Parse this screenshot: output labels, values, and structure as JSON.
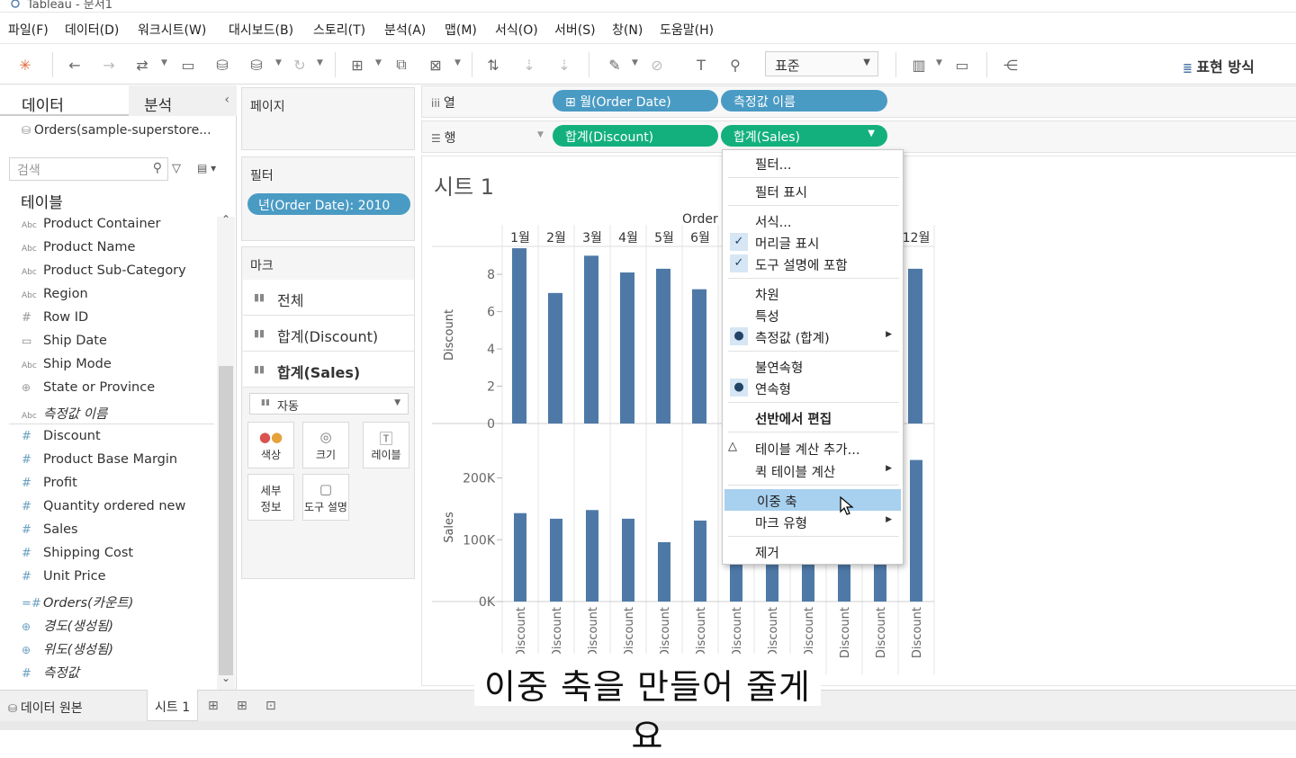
{
  "window": {
    "title": "Tableau - 문서1"
  },
  "menu": [
    "파일(F)",
    "데이터(D)",
    "워크시트(W)",
    "대시보드(B)",
    "스토리(T)",
    "분석(A)",
    "맵(M)",
    "서식(O)",
    "서버(S)",
    "창(N)",
    "도움말(H)"
  ],
  "toolbar": {
    "fit": "표준",
    "show_me": "표현 방식"
  },
  "data_pane": {
    "tab_data": "데이터",
    "tab_analysis": "분석",
    "datasource": "Orders(sample-superstore...",
    "search_placeholder": "검색",
    "tables_header": "테이블",
    "dimensions": [
      {
        "icon": "Abc",
        "label": "Product Container"
      },
      {
        "icon": "Abc",
        "label": "Product Name"
      },
      {
        "icon": "Abc",
        "label": "Product Sub-Category"
      },
      {
        "icon": "Abc",
        "label": "Region"
      },
      {
        "icon": "#",
        "label": "Row ID"
      },
      {
        "icon": "calendar",
        "label": "Ship Date"
      },
      {
        "icon": "Abc",
        "label": "Ship Mode"
      },
      {
        "icon": "globe",
        "label": "State or Province"
      },
      {
        "icon": "Abc",
        "label": "측정값 이름"
      }
    ],
    "measures": [
      {
        "icon": "#",
        "label": "Discount"
      },
      {
        "icon": "#",
        "label": "Product Base Margin"
      },
      {
        "icon": "#",
        "label": "Profit"
      },
      {
        "icon": "#",
        "label": "Quantity ordered new"
      },
      {
        "icon": "#",
        "label": "Sales"
      },
      {
        "icon": "#",
        "label": "Shipping Cost"
      },
      {
        "icon": "#",
        "label": "Unit Price"
      },
      {
        "icon": "=#",
        "label": "Orders(카운트)"
      },
      {
        "icon": "globe",
        "label": "경도(생성됨)"
      },
      {
        "icon": "globe",
        "label": "위도(생성됨)"
      },
      {
        "icon": "#",
        "label": "측정값"
      }
    ]
  },
  "cards": {
    "pages": "페이지",
    "filters": "필터",
    "filter_pill": "년(Order Date): 2010",
    "marks": "마크",
    "mark_rows": [
      "전체",
      "합계(Discount)",
      "합계(Sales)"
    ],
    "mark_type": "자동",
    "buttons": {
      "color": "색상",
      "size": "크기",
      "label": "레이블",
      "detail": "세부\n정보",
      "tooltip": "도구 설명"
    }
  },
  "shelves": {
    "columns_label": "열",
    "rows_label": "행",
    "columns_pills": [
      "월(Order Date)",
      "측정값 이름"
    ],
    "rows_pills": [
      "합계(Discount)",
      "합계(Sales)"
    ]
  },
  "view": {
    "sheet_title": "시트 1",
    "header_partial": "Order"
  },
  "chart_data": {
    "type": "bar",
    "categories": [
      "1월",
      "2월",
      "3월",
      "4월",
      "5월",
      "6월",
      "7월",
      "8월",
      "9월",
      "10월",
      "11월",
      "12월"
    ],
    "visible_categories": [
      "1월",
      "2월",
      "3월",
      "4월",
      "5월",
      "6월",
      "12월"
    ],
    "column_sublabel": "Discount",
    "panes": [
      {
        "name": "Discount",
        "ylabel": "Discount",
        "ylim": [
          0,
          9.5
        ],
        "ticks": [
          0,
          2,
          4,
          6,
          8
        ],
        "tick_labels": [
          "0",
          "2",
          "4",
          "6",
          "8"
        ],
        "values": [
          9.4,
          7.0,
          9.0,
          8.1,
          8.3,
          7.2,
          null,
          null,
          null,
          null,
          null,
          8.3
        ]
      },
      {
        "name": "Sales",
        "ylabel": "Sales",
        "ylim": [
          0,
          240000
        ],
        "ticks": [
          0,
          100000,
          200000
        ],
        "tick_labels": [
          "0K",
          "100K",
          "200K"
        ],
        "values": [
          143000,
          134000,
          148000,
          134000,
          96000,
          131000,
          88000,
          84000,
          78000,
          86000,
          94000,
          229000
        ]
      }
    ],
    "bar_color": "#4e79a7"
  },
  "context_menu": {
    "items": [
      "필터...",
      "필터 표시",
      "서식...",
      "머리글 표시",
      "도구 설명에 포함",
      "차원",
      "특성",
      "측정값 (합계)",
      "불연속형",
      "연속형",
      "선반에서 편집",
      "테이블 계산 추가...",
      "퀵 테이블 계산",
      "이중 축",
      "마크 유형",
      "제거"
    ],
    "highlighted": "이중 축"
  },
  "bottom": {
    "source_tab": "데이터 원본",
    "sheet_tab": "시트 1"
  },
  "caption": "이중 축을 만들어 줄게요",
  "colors": {
    "blue_pill": "#4a9bc4",
    "green_pill": "#13b07d",
    "highlight": "#a8d0ef"
  }
}
